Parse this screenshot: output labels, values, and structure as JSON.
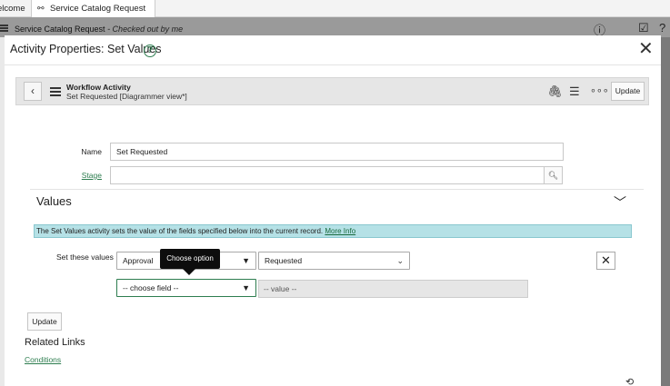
{
  "tabs": {
    "welcome": "elcome",
    "active": "Service Catalog Request"
  },
  "bg_header": {
    "title": "Service Catalog Request",
    "subtitle": " - Checked out by me"
  },
  "modal": {
    "title": "Activity Properties: Set Values",
    "help_glyph": "?",
    "close_glyph": "✕"
  },
  "form_header": {
    "title": "Workflow Activity",
    "subtitle": "Set Requested [Diagrammer view*]",
    "update_label": "Update"
  },
  "fields": {
    "name_label": "Name",
    "name_value": "Set Requested",
    "stage_label": "Stage",
    "stage_value": ""
  },
  "values_section": {
    "title": "Values",
    "info_text": "The Set Values activity sets the value of the fields specified below into the current record. ",
    "more_info": "More Info",
    "set_label": "Set these values",
    "field_1": "Approval",
    "value_1": "Requested",
    "field_2": "-- choose field --",
    "value_2_placeholder": "-- value --",
    "tooltip": "Choose option"
  },
  "footer": {
    "update_label": "Update",
    "related_title": "Related Links",
    "conditions_link": "Conditions"
  },
  "colors": {
    "accent_green": "#2d7d4f",
    "info_bg": "#b5e1e6"
  }
}
